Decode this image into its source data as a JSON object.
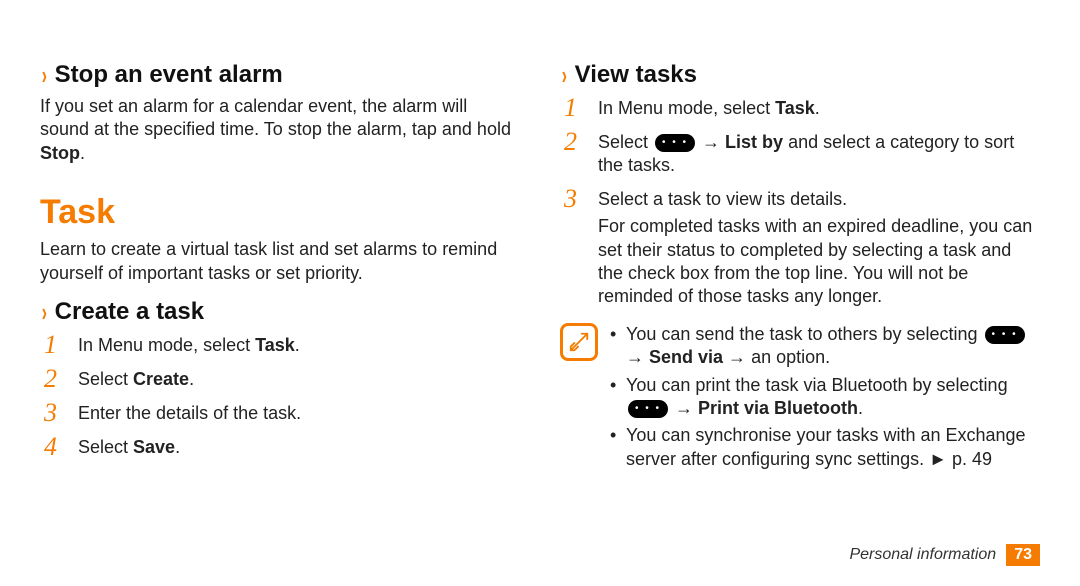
{
  "left": {
    "stop_alarm": {
      "heading": "Stop an event alarm",
      "body_pre": "If you set an alarm for a calendar event, the alarm will sound at the specified time. To stop the alarm, tap and hold ",
      "body_bold": "Stop",
      "body_post": "."
    },
    "task_section": {
      "heading": "Task",
      "intro": "Learn to create a virtual task list and set alarms to remind yourself of important tasks or set priority."
    },
    "create_task": {
      "heading": "Create a task",
      "steps": [
        {
          "num": "1",
          "pre": "In Menu mode, select ",
          "bold": "Task",
          "post": "."
        },
        {
          "num": "2",
          "pre": "Select ",
          "bold": "Create",
          "post": "."
        },
        {
          "num": "3",
          "pre": "Enter the details of the task.",
          "bold": "",
          "post": ""
        },
        {
          "num": "4",
          "pre": "Select ",
          "bold": "Save",
          "post": "."
        }
      ]
    }
  },
  "right": {
    "view_tasks": {
      "heading": "View tasks",
      "step1": {
        "num": "1",
        "pre": "In Menu mode, select ",
        "bold": "Task",
        "post": "."
      },
      "step2": {
        "num": "2",
        "pre": "Select ",
        "arrow": " → ",
        "bold": "List by",
        "post": " and select a category to sort the tasks."
      },
      "step3": {
        "num": "3",
        "line1": "Select a task to view its details.",
        "line2": "For completed tasks with an expired deadline, you can set their status to completed by selecting a task and the check box from the top line. You will not be reminded of those tasks any longer."
      }
    },
    "note": {
      "b1": {
        "pre": "You can send the task to others by selecting ",
        "arrow1": " → ",
        "bold": "Send via",
        "arrow2": " → ",
        "post": "an option."
      },
      "b2": {
        "pre": "You can print the task via Bluetooth by selecting ",
        "arrow": " → ",
        "bold": "Print via Bluetooth",
        "post": "."
      },
      "b3": {
        "pre": "You can synchronise your tasks with an Exchange server after configuring sync settings. ",
        "ref": "► p. 49"
      }
    }
  },
  "footer": {
    "label": "Personal information",
    "page": "73"
  }
}
